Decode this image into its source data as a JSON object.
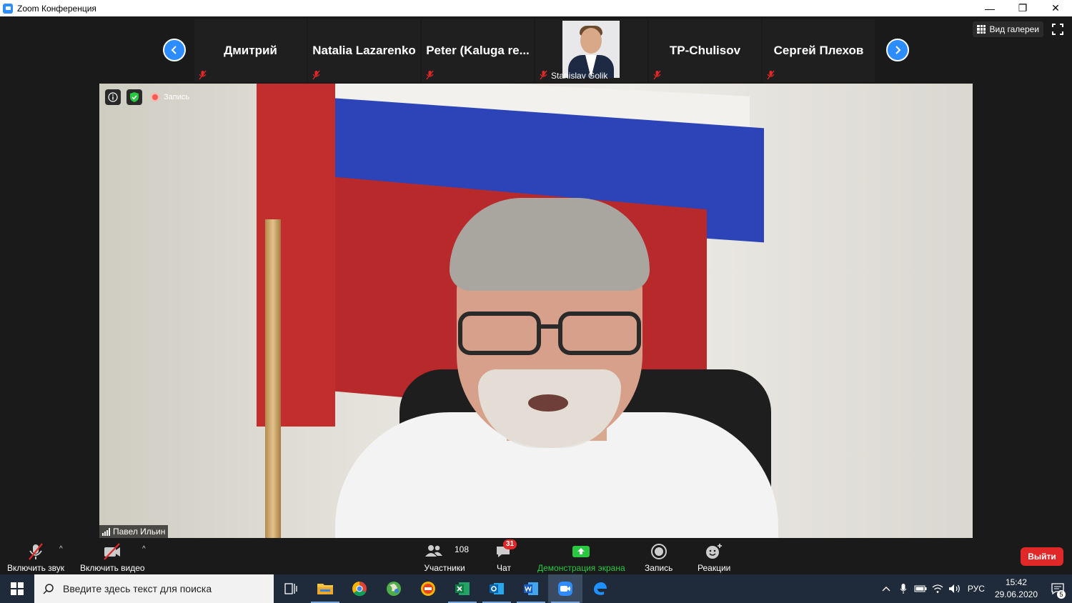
{
  "window": {
    "title": "Zoom Конференция",
    "minimize": "—",
    "restore": "❐",
    "close": "✕"
  },
  "gallery_strip": {
    "participants": [
      {
        "name": "Дмитрий",
        "muted": true
      },
      {
        "name": "Natalia Lazarenko",
        "muted": true
      },
      {
        "name": "Peter  (Kaluga re...",
        "muted": true
      },
      {
        "name": "Stanislav Golik",
        "muted": true,
        "video": true
      },
      {
        "name": "TP-Chulisov",
        "muted": true
      },
      {
        "name": "Сергей Плехов",
        "muted": true
      }
    ]
  },
  "view_controls": {
    "gallery_view_label": "Вид галереи"
  },
  "main_video": {
    "recording_label": "Запись",
    "speaker_name": "Павел Ильин"
  },
  "toolbar": {
    "unmute_label": "Включить звук",
    "start_video_label": "Включить видео",
    "participants_label": "Участники",
    "participants_count": "108",
    "chat_label": "Чат",
    "chat_badge": "31",
    "share_screen_label": "Демонстрация экрана",
    "record_label": "Запись",
    "reactions_label": "Реакции",
    "leave_label": "Выйти"
  },
  "taskbar": {
    "search_placeholder": "Введите здесь текст для поиска",
    "language": "РУС",
    "time": "15:42",
    "date": "29.06.2020",
    "notification_count": "5"
  },
  "colors": {
    "zoom_blue": "#2d8cff",
    "share_green": "#28c840",
    "leave_red": "#e02828",
    "mute_red": "#e02828"
  }
}
